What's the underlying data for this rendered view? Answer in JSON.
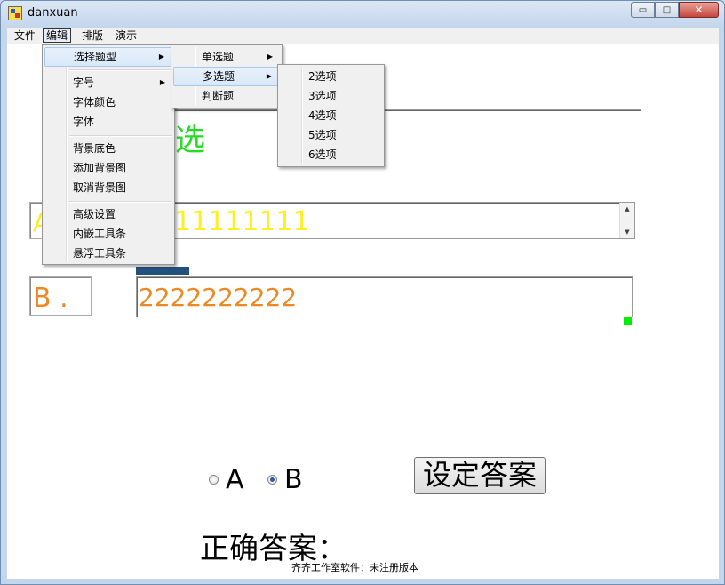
{
  "window": {
    "title": "danxuan",
    "minimize_glyph": "▭",
    "maximize_glyph": "□",
    "close_glyph": "✕"
  },
  "menubar": [
    "文件",
    "编辑",
    "排版",
    "演示"
  ],
  "question_text": "选",
  "option_a": {
    "label": "A",
    "text": "11111111"
  },
  "option_b": {
    "label": "B .",
    "text": "2222222222"
  },
  "radios": {
    "a": "A",
    "b": "B",
    "selected": "B"
  },
  "set_answer_button": "设定答案",
  "correct_answer_label": "正确答案：",
  "status_text": "齐齐工作室软件：未注册版本",
  "edit_menu": {
    "group1": [
      {
        "label": "选择题型",
        "submenu": true
      }
    ],
    "group2": [
      {
        "label": "字号",
        "submenu": true
      },
      {
        "label": "字体颜色"
      },
      {
        "label": "字体"
      }
    ],
    "group3": [
      {
        "label": "背景底色"
      },
      {
        "label": "添加背景图"
      },
      {
        "label": "取消背景图"
      }
    ],
    "group4": [
      {
        "label": "高级设置"
      },
      {
        "label": "内嵌工具条"
      },
      {
        "label": "悬浮工具条"
      }
    ]
  },
  "type_submenu": [
    {
      "label": "单选题",
      "submenu": true
    },
    {
      "label": "多选题",
      "submenu": true
    },
    {
      "label": "判断题"
    }
  ],
  "multi_submenu": [
    "2选项",
    "3选项",
    "4选项",
    "5选项",
    "6选项"
  ],
  "colors": {
    "question": "#22dd22",
    "option_a": "#ffee22",
    "option_b": "#ee8822",
    "handle": "#00ee00",
    "bar": "#24507e"
  }
}
